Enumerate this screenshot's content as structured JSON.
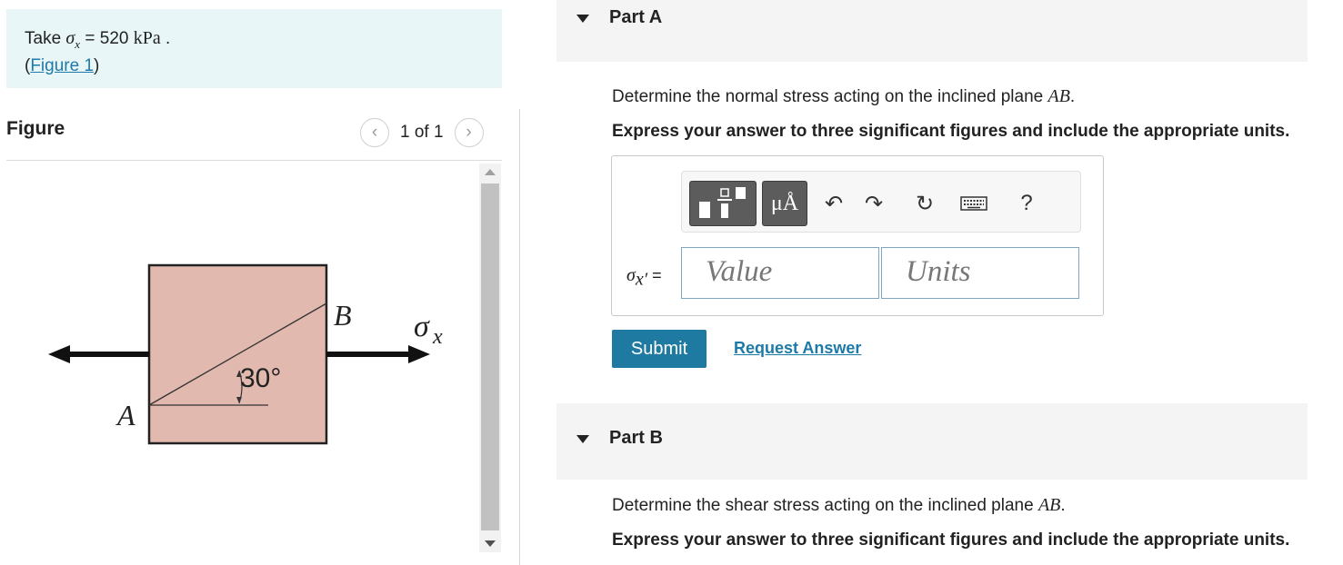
{
  "given": {
    "take": "Take",
    "sigma": "σ",
    "sub": "x",
    "equals": "=",
    "value": "520",
    "unit": "kPa",
    "period": ".",
    "figure_open": "(",
    "figure_link": "Figure 1",
    "figure_close": ")"
  },
  "figure": {
    "title": "Figure",
    "counter": "1 of 1",
    "label_a": "A",
    "label_b": "B",
    "label_sigma": "σ",
    "label_sigma_sub": "x",
    "angle": "30°"
  },
  "part_a": {
    "title": "Part A",
    "question_prefix": "Determine the normal stress acting on the inclined plane",
    "plane": "AB",
    "period": ".",
    "instruction": "Express your answer to three significant figures and include the appropriate units.",
    "answer_label": "σ",
    "answer_label_sub": "x′",
    "answer_equals": "=",
    "value_placeholder": "Value",
    "units_placeholder": "Units",
    "submit": "Submit",
    "request": "Request Answer",
    "toolbar_units": "μÅ",
    "toolbar_help": "?"
  },
  "part_b": {
    "title": "Part B",
    "question_prefix": "Determine the shear stress acting on the inclined plane",
    "plane": "AB",
    "period": ".",
    "instruction": "Express your answer to three significant figures and include the appropriate units."
  },
  "colors": {
    "block_fill": "#e2b9ae",
    "given_bg": "#e8f6f7",
    "submit_bg": "#1f7aa2",
    "link": "#1e7aa8"
  }
}
